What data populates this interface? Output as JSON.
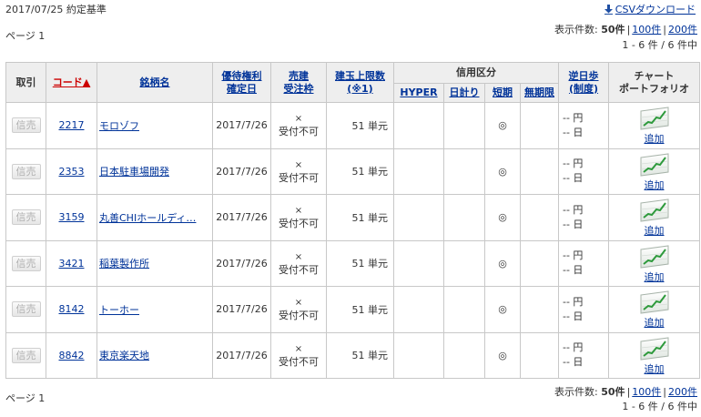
{
  "header": {
    "date_basis": "2017/07/25 約定基準",
    "csv_label": "CSVダウンロード"
  },
  "pager": {
    "page_label": "ページ 1",
    "display_count_prefix": "表示件数:",
    "count_50": "50件",
    "count_100": "100件",
    "count_200": "200件",
    "range_label": "1 - 6 件 / 6 件中"
  },
  "table": {
    "headers": {
      "trade": "取引",
      "code": "コード▲",
      "name": "銘柄名",
      "benefit_date": [
        "優待権利",
        "確定日"
      ],
      "short_accept": [
        "売建",
        "受注枠"
      ],
      "position_limit": [
        "建玉上限数",
        "(※1)"
      ],
      "margin_type": "信用区分",
      "hyper": "HYPER",
      "daily": "日計り",
      "short_term": "短期",
      "unlimited": "無期限",
      "reverse_fee": [
        "逆日歩",
        "(制度)"
      ],
      "chart": [
        "チャート",
        "ポートフォリオ"
      ]
    },
    "rows": [
      {
        "btn": "信売",
        "code": "2217",
        "name": "モロゾフ",
        "date": "2017/7/26",
        "accept_mark": "×",
        "accept_text": "受付不可",
        "limit": "51 単元",
        "hyper": "",
        "daily": "",
        "short": "◎",
        "unlimited": "",
        "yen": "-- 円",
        "day": "-- 日",
        "add": "追加"
      },
      {
        "btn": "信売",
        "code": "2353",
        "name": "日本駐車場開発",
        "date": "2017/7/26",
        "accept_mark": "×",
        "accept_text": "受付不可",
        "limit": "51 単元",
        "hyper": "",
        "daily": "",
        "short": "◎",
        "unlimited": "",
        "yen": "-- 円",
        "day": "-- 日",
        "add": "追加"
      },
      {
        "btn": "信売",
        "code": "3159",
        "name": "丸善CHIホールディ…",
        "date": "2017/7/26",
        "accept_mark": "×",
        "accept_text": "受付不可",
        "limit": "51 単元",
        "hyper": "",
        "daily": "",
        "short": "◎",
        "unlimited": "",
        "yen": "-- 円",
        "day": "-- 日",
        "add": "追加"
      },
      {
        "btn": "信売",
        "code": "3421",
        "name": "稲葉製作所",
        "date": "2017/7/26",
        "accept_mark": "×",
        "accept_text": "受付不可",
        "limit": "51 単元",
        "hyper": "",
        "daily": "",
        "short": "◎",
        "unlimited": "",
        "yen": "-- 円",
        "day": "-- 日",
        "add": "追加"
      },
      {
        "btn": "信売",
        "code": "8142",
        "name": "トーホー",
        "date": "2017/7/26",
        "accept_mark": "×",
        "accept_text": "受付不可",
        "limit": "51 単元",
        "hyper": "",
        "daily": "",
        "short": "◎",
        "unlimited": "",
        "yen": "-- 円",
        "day": "-- 日",
        "add": "追加"
      },
      {
        "btn": "信売",
        "code": "8842",
        "name": "東京楽天地",
        "date": "2017/7/26",
        "accept_mark": "×",
        "accept_text": "受付不可",
        "limit": "51 単元",
        "hyper": "",
        "daily": "",
        "short": "◎",
        "unlimited": "",
        "yen": "-- 円",
        "day": "-- 日",
        "add": "追加"
      }
    ]
  },
  "icons": {
    "csv": "download-arrow-icon",
    "chart": "chart-thumbnail-icon"
  },
  "colors": {
    "link": "#003399",
    "sort_active": "#cc0000",
    "header_bg": "#eeeeee",
    "border": "#c8c8c8"
  }
}
